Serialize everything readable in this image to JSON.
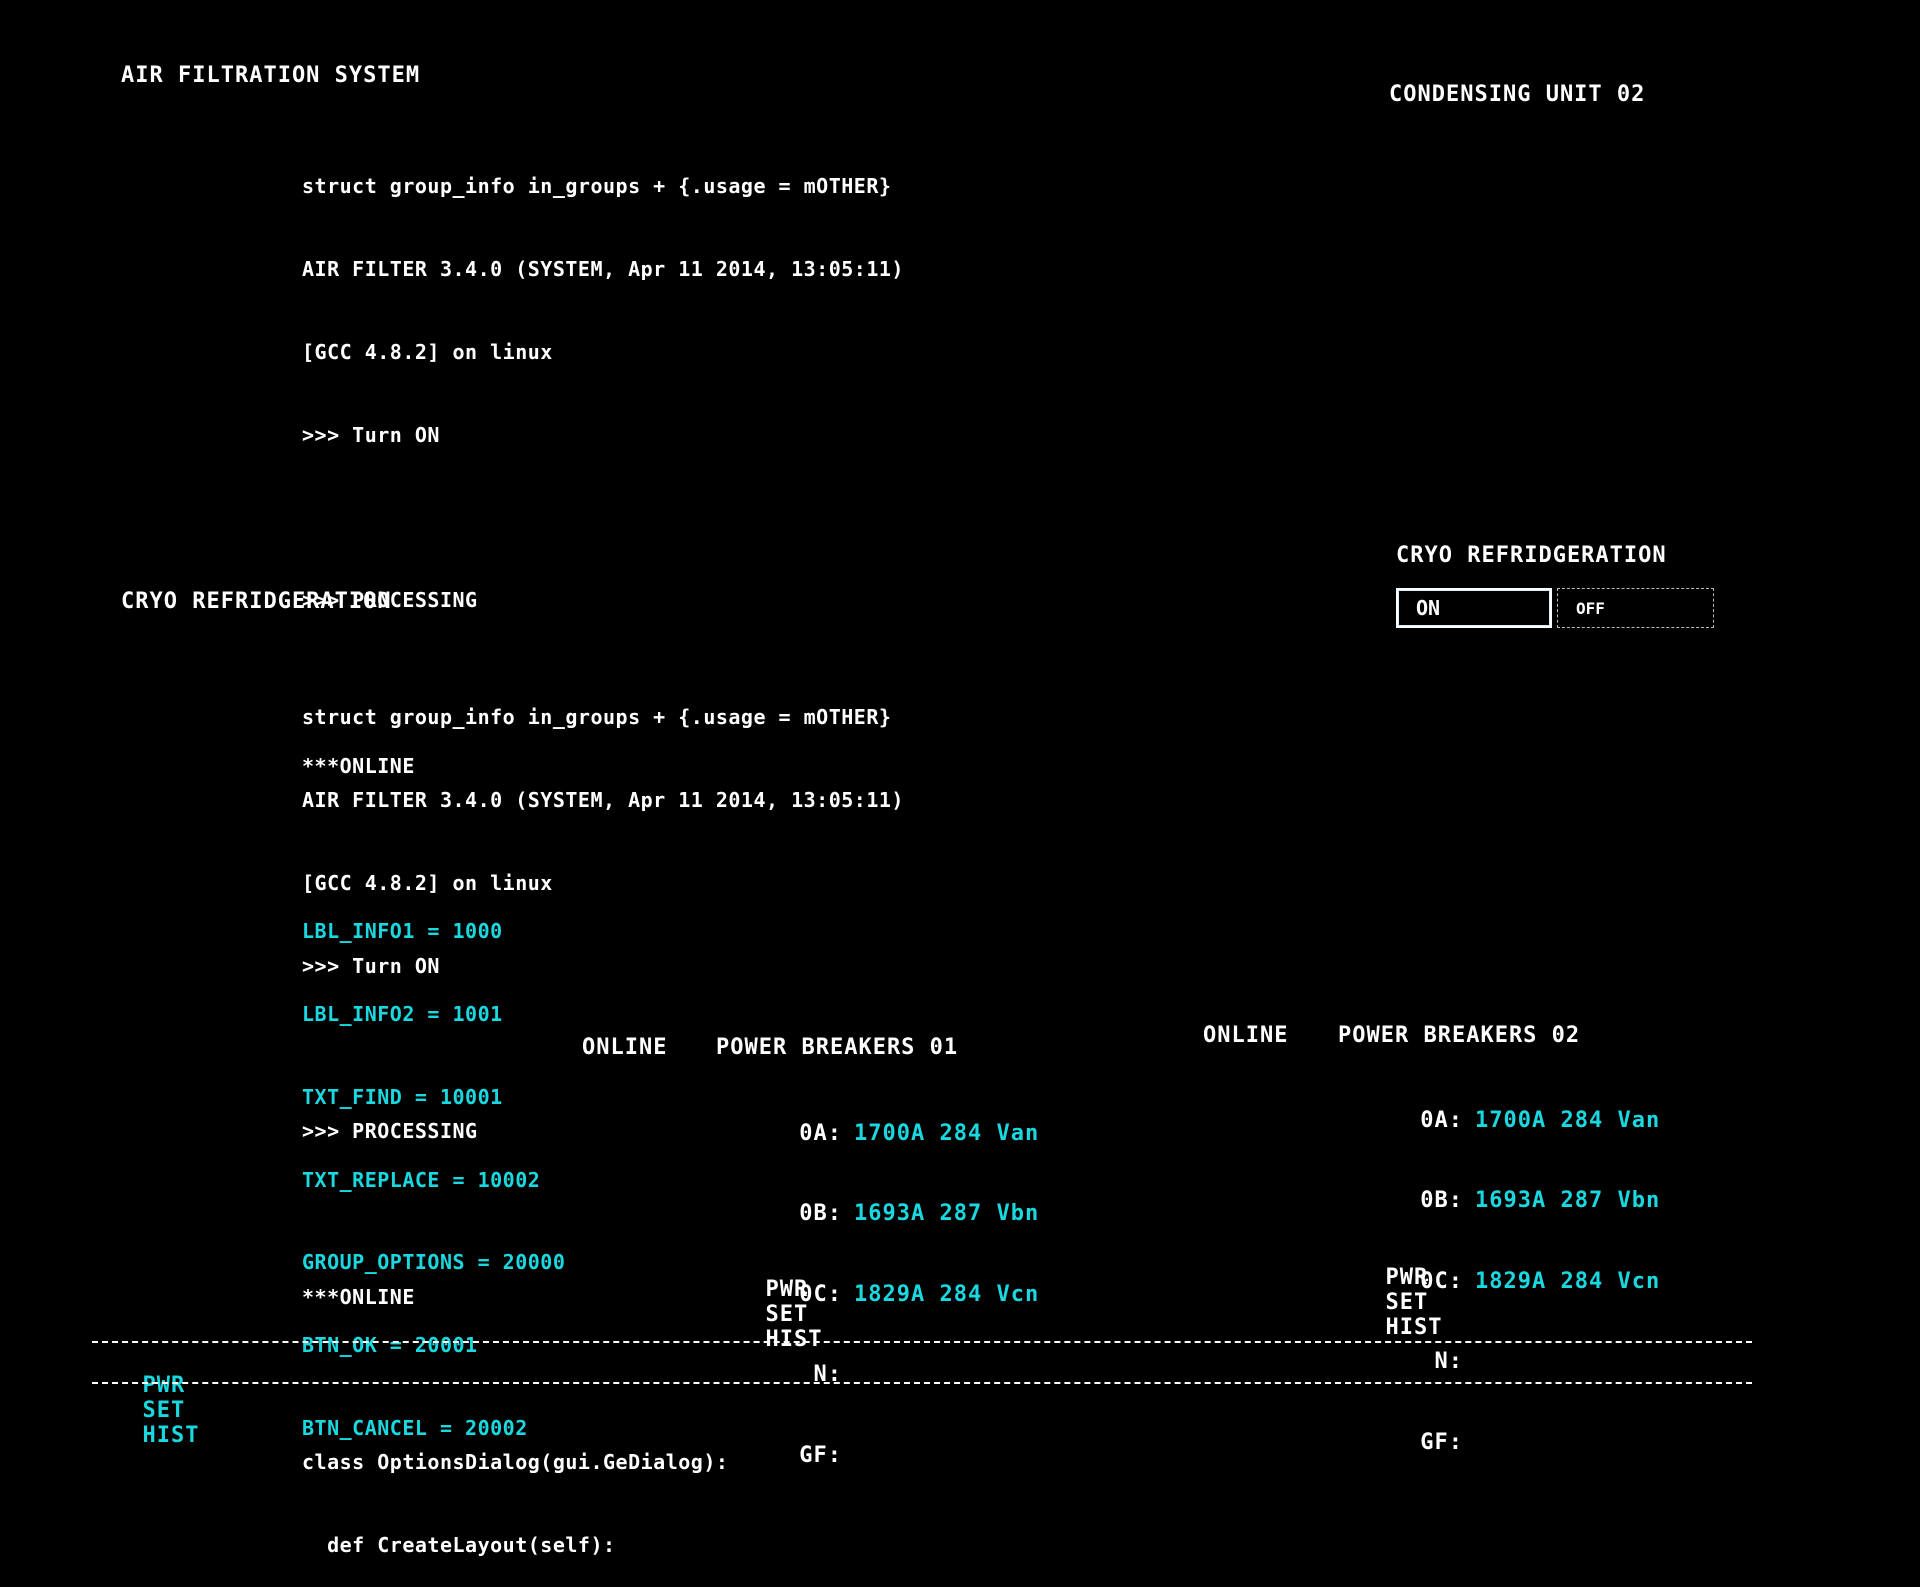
{
  "left_panel": {
    "air_title": "AIR FILTRATION SYSTEM",
    "air_block_1": [
      "struct group_info in_groups + {.usage = mOTHER}",
      "AIR FILTER 3.4.0 (SYSTEM, Apr 11 2014, 13:05:11)",
      "[GCC 4.8.2] on linux",
      ">>> Turn ON",
      "",
      ">>> PROCESSING",
      "",
      "***ONLINE",
      ""
    ],
    "air_block_2": [
      "LBL_INFO1 = 1000",
      "LBL_INFO2 = 1001",
      "TXT_FIND = 10001",
      "TXT_REPLACE = 10002",
      "GROUP_OPTIONS = 20000",
      "BTN_OK = 20001",
      "BTN_CANCEL = 20002"
    ],
    "cryo_title": "CRYO REFRIDGERATION",
    "cryo_block": [
      "struct group_info in_groups + {.usage = mOTHER}",
      "AIR FILTER 3.4.0 (SYSTEM, Apr 11 2014, 13:05:11)",
      "[GCC 4.8.2] on linux",
      ">>> Turn ON",
      "",
      ">>> PROCESSING",
      "",
      "***ONLINE",
      "",
      "class OptionsDialog(gui.GeDialog):",
      "  def CreateLayout(self):"
    ]
  },
  "right_panel": {
    "condensing_title": "CONDENSING UNIT 02",
    "cryo_title": "CRYO REFRIDGERATION",
    "toggle_on": "ON",
    "toggle_off": "OFF",
    "selected": "ON"
  },
  "breakers_01": {
    "status": "ONLINE",
    "title": "POWER BREAKERS 01",
    "rows": [
      {
        "key": "0A:",
        "value": "1700A 284 Van"
      },
      {
        "key": "0B:",
        "value": "1693A 287 Vbn"
      },
      {
        "key": "0C:",
        "value": "1829A 284 Vcn"
      },
      {
        "key": "N:",
        "value": ""
      },
      {
        "key": "GF:",
        "value": ""
      }
    ],
    "menu": [
      "PWR",
      "SET",
      "HIST"
    ]
  },
  "breakers_02": {
    "status": "ONLINE",
    "title": "POWER BREAKERS 02",
    "rows": [
      {
        "key": "0A:",
        "value": "1700A 284 Van"
      },
      {
        "key": "0B:",
        "value": "1693A 287 Vbn"
      },
      {
        "key": "0C:",
        "value": "1829A 284 Vcn"
      },
      {
        "key": "N:",
        "value": ""
      },
      {
        "key": "GF:",
        "value": ""
      }
    ],
    "menu": [
      "PWR",
      "SET",
      "HIST"
    ]
  },
  "footer_menu": [
    "PWR",
    "SET",
    "HIST"
  ],
  "colors": {
    "background": "#000000",
    "text": "#ffffff",
    "accent": "#1ad8e0"
  }
}
